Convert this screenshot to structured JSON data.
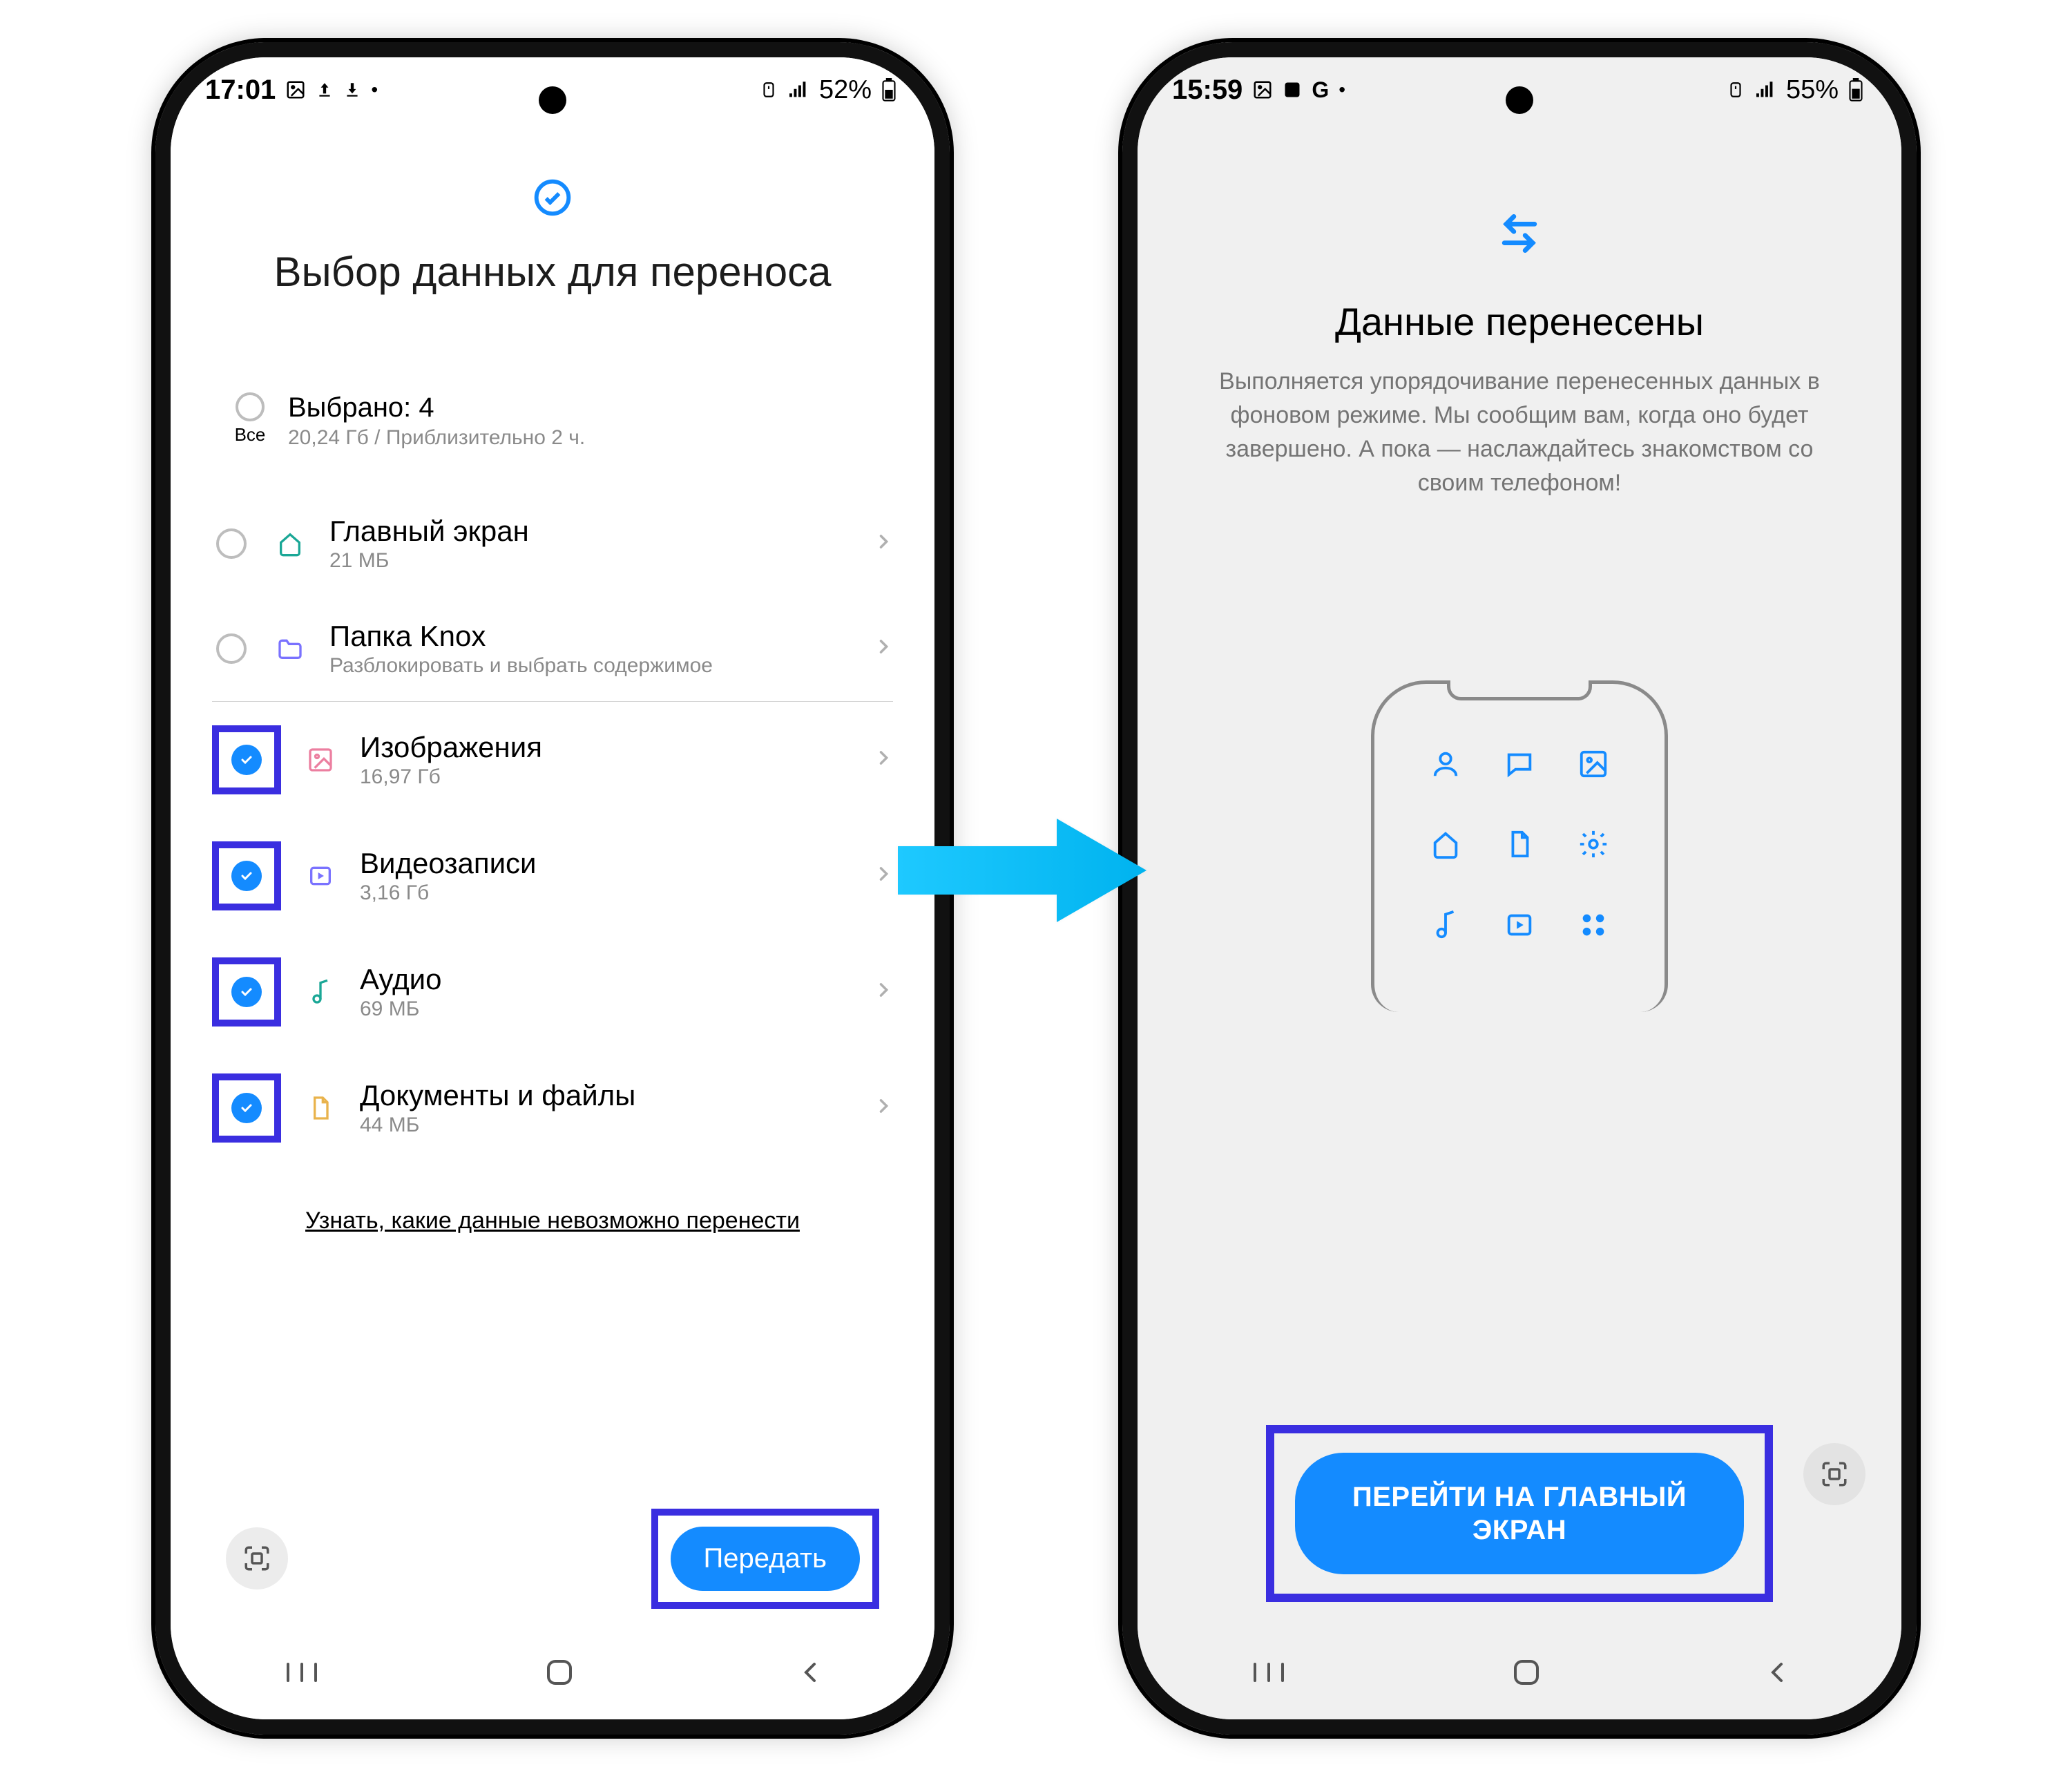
{
  "phone1": {
    "status": {
      "time": "17:01",
      "battery": "52%"
    },
    "header": {
      "title": "Выбор данных для переноса"
    },
    "select_all": {
      "label": "Все",
      "selected": "Выбрано: 4",
      "summary": "20,24 Гб / Приблизительно 2 ч."
    },
    "items": [
      {
        "name": "Главный экран",
        "sub": "21 МБ",
        "checked": false,
        "highlight": false,
        "icon": "home",
        "icon_color": "#1aa796"
      },
      {
        "name": "Папка Knox",
        "sub": "Разблокировать и выбрать содержимое",
        "checked": false,
        "highlight": false,
        "icon": "folder",
        "icon_color": "#7a72ff"
      },
      {
        "name": "Изображения",
        "sub": "16,97 Гб",
        "checked": true,
        "highlight": true,
        "icon": "image",
        "icon_color": "#ec7fa0"
      },
      {
        "name": "Видеозаписи",
        "sub": "3,16 Гб",
        "checked": true,
        "highlight": true,
        "icon": "video",
        "icon_color": "#7a72ff"
      },
      {
        "name": "Аудио",
        "sub": "69 МБ",
        "checked": true,
        "highlight": true,
        "icon": "audio",
        "icon_color": "#1aa796"
      },
      {
        "name": "Документы и файлы",
        "sub": "44 МБ",
        "checked": true,
        "highlight": true,
        "icon": "doc",
        "icon_color": "#e9b34c"
      }
    ],
    "learn_more": "Узнать, какие данные невозможно перенести",
    "send_button": "Передать"
  },
  "phone2": {
    "status": {
      "time": "15:59",
      "battery": "55%"
    },
    "header": {
      "title": "Данные перенесены"
    },
    "description": "Выполняется упорядочивание перенесенных данных в фоновом режиме. Мы сообщим вам, когда оно будет завершено. А пока — наслаждайтесь знакомством со своим телефоном!",
    "home_button": "ПЕРЕЙТИ НА ГЛАВНЫЙ ЭКРАН"
  },
  "colors": {
    "accent": "#148bff",
    "highlight": "#3a2ee0",
    "arrow": "#1ec9ff"
  }
}
